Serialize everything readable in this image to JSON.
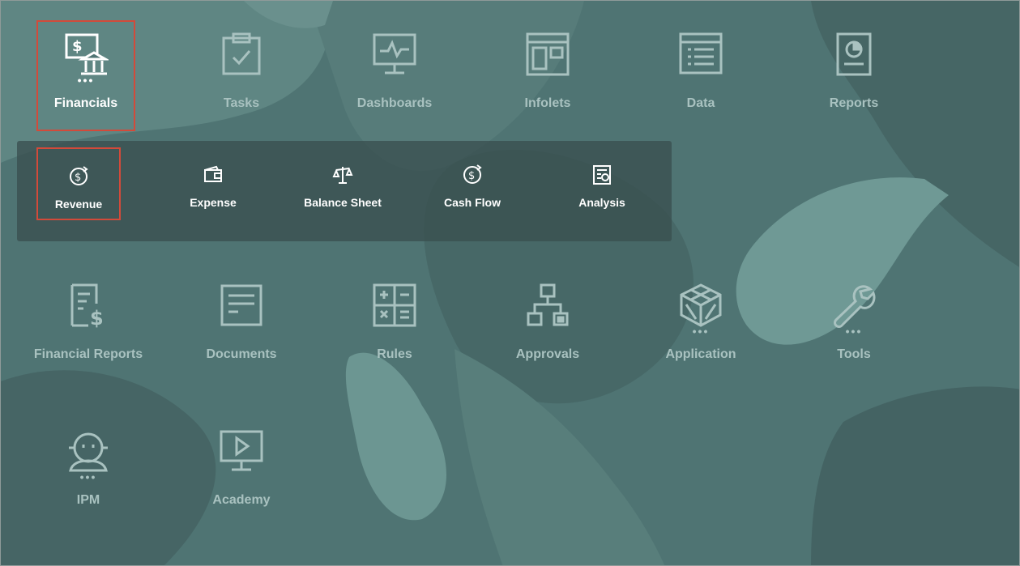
{
  "colors": {
    "background": "#4f7473",
    "icon_muted": "#a9c2c0",
    "active_text": "#ffffff",
    "selection_border": "#d34a3a",
    "submenu_bg": "#3a5050"
  },
  "top_row": [
    {
      "label": "Financials",
      "icon": "bank-dollar-icon",
      "has_more": true,
      "active": true
    },
    {
      "label": "Tasks",
      "icon": "clipboard-check-icon"
    },
    {
      "label": "Dashboards",
      "icon": "monitor-pulse-icon"
    },
    {
      "label": "Infolets",
      "icon": "layout-panels-icon"
    },
    {
      "label": "Data",
      "icon": "data-list-icon"
    },
    {
      "label": "Reports",
      "icon": "report-pie-icon"
    }
  ],
  "more_indicator": "•••",
  "submenu": [
    {
      "label": "Revenue",
      "icon": "dollar-cycle-icon",
      "selected": true
    },
    {
      "label": "Expense",
      "icon": "wallet-icon"
    },
    {
      "label": "Balance Sheet",
      "icon": "scales-icon"
    },
    {
      "label": "Cash Flow",
      "icon": "dollar-cycle-icon"
    },
    {
      "label": "Analysis",
      "icon": "analysis-report-icon"
    }
  ],
  "middle_row": [
    {
      "label": "Financial Reports",
      "icon": "financial-report-icon"
    },
    {
      "label": "Documents",
      "icon": "document-icon"
    },
    {
      "label": "Rules",
      "icon": "calculator-icon"
    },
    {
      "label": "Approvals",
      "icon": "hierarchy-icon"
    },
    {
      "label": "Application",
      "icon": "cube-icon",
      "has_more": true
    },
    {
      "label": "Tools",
      "icon": "wrench-icon",
      "has_more": true
    }
  ],
  "bottom_row": [
    {
      "label": "IPM",
      "icon": "robot-icon",
      "has_more": true
    },
    {
      "label": "Academy",
      "icon": "play-monitor-icon"
    }
  ]
}
